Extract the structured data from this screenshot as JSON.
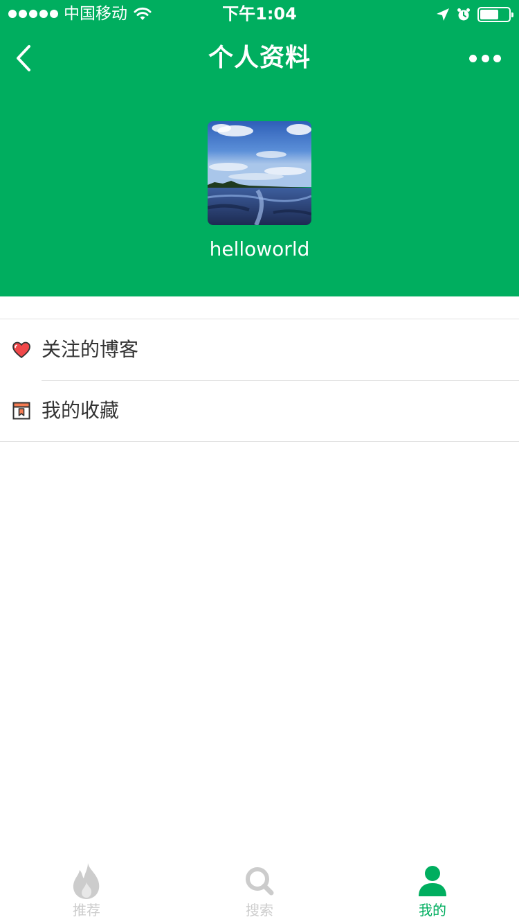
{
  "status_bar": {
    "carrier": "中国移动",
    "time": "下午1:04",
    "battery_level": 0.65
  },
  "nav": {
    "title": "个人资料"
  },
  "profile": {
    "username": "helloworld"
  },
  "menu": {
    "items": [
      {
        "label": "关注的博客",
        "icon": "heart-icon"
      },
      {
        "label": "我的收藏",
        "icon": "bookmark-icon"
      }
    ]
  },
  "tabbar": {
    "tabs": [
      {
        "label": "推荐",
        "icon": "flame-icon",
        "active": false
      },
      {
        "label": "搜索",
        "icon": "search-icon",
        "active": false
      },
      {
        "label": "我的",
        "icon": "person-icon",
        "active": true
      }
    ]
  },
  "colors": {
    "primary": "#00AE5F",
    "tab_inactive": "#cccccc",
    "tab_active": "#00AE5F",
    "heart": "#F0484A",
    "bookmark": "#F47B52"
  }
}
